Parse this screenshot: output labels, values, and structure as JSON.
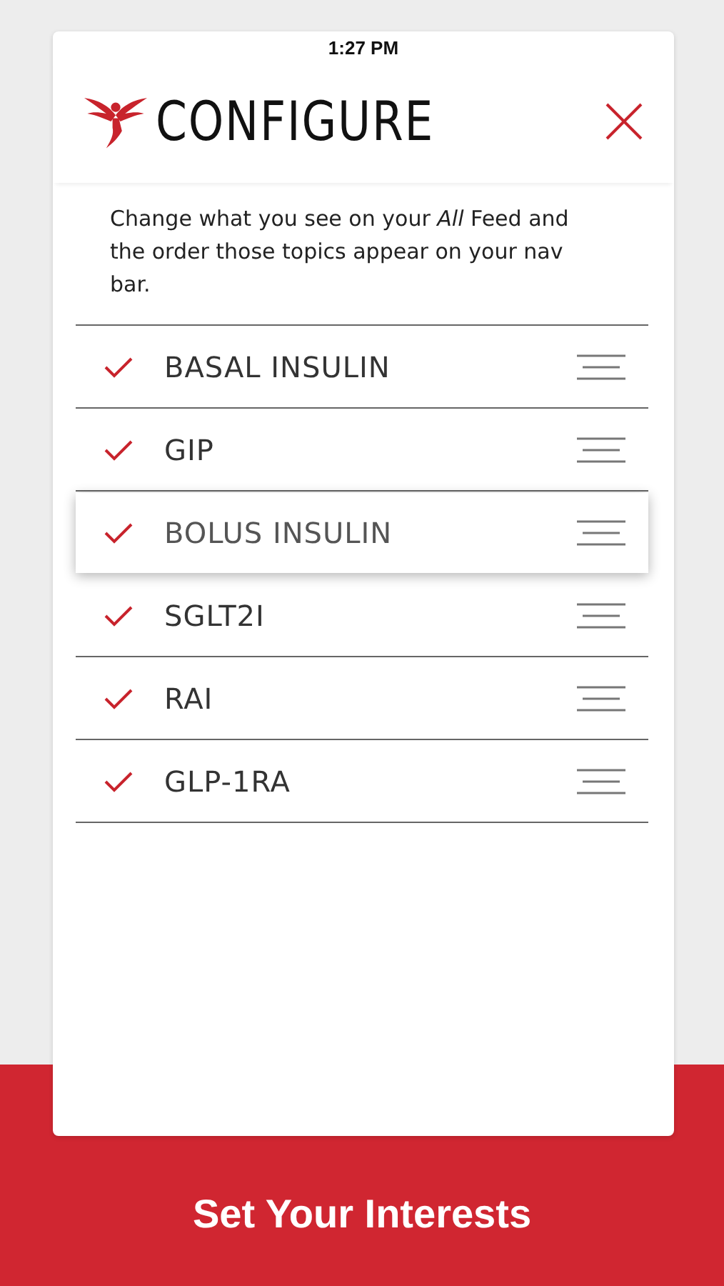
{
  "status_bar": {
    "time": "1:27 PM"
  },
  "header": {
    "title": "CONFIGURE"
  },
  "description": "Change what you see on your *All* Feed and the order those topics appear on your nav bar.",
  "topics": [
    {
      "label": "BASAL INSULIN",
      "checked": true,
      "kind": "row"
    },
    {
      "label": "GIP",
      "checked": true,
      "kind": "row"
    },
    {
      "kind": "placeholder"
    },
    {
      "label": "SGLT2I",
      "checked": true,
      "kind": "row"
    },
    {
      "label": "RAI",
      "checked": true,
      "kind": "row"
    },
    {
      "label": "GLP-1RA",
      "checked": true,
      "kind": "row"
    }
  ],
  "dragged_topic": {
    "label": "BOLUS INSULIN",
    "checked": true
  },
  "footer": {
    "button": "Set Your Interests"
  }
}
